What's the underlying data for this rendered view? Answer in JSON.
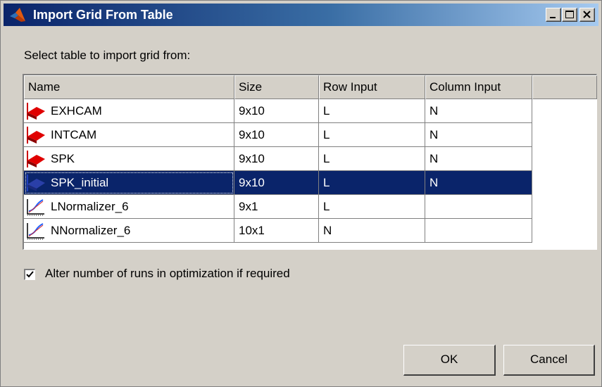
{
  "window": {
    "title": "Import Grid From Table",
    "controls": {
      "minimize": "_",
      "maximize": "□",
      "close": "X"
    }
  },
  "prompt": "Select table to import grid from:",
  "table": {
    "columns": [
      "Name",
      "Size",
      "Row Input",
      "Column Input"
    ],
    "rows": [
      {
        "name": "EXHCAM",
        "size": "9x10",
        "row_input": "L",
        "column_input": "N",
        "icon": "table-2d-icon",
        "selected": false
      },
      {
        "name": "INTCAM",
        "size": "9x10",
        "row_input": "L",
        "column_input": "N",
        "icon": "table-2d-icon",
        "selected": false
      },
      {
        "name": "SPK",
        "size": "9x10",
        "row_input": "L",
        "column_input": "N",
        "icon": "table-2d-icon",
        "selected": false
      },
      {
        "name": "SPK_initial",
        "size": "9x10",
        "row_input": "L",
        "column_input": "N",
        "icon": "table-2d-icon",
        "selected": true
      },
      {
        "name": "LNormalizer_6",
        "size": "9x1",
        "row_input": "L",
        "column_input": "",
        "icon": "normalizer-icon",
        "selected": false
      },
      {
        "name": "NNormalizer_6",
        "size": "10x1",
        "row_input": "N",
        "column_input": "",
        "icon": "normalizer-icon",
        "selected": false
      }
    ]
  },
  "option": {
    "label": "Alter number of runs in optimization if required",
    "checked": true
  },
  "buttons": {
    "ok": "OK",
    "cancel": "Cancel"
  },
  "colors": {
    "title_start": "#0a246a",
    "title_end": "#a6caf0",
    "selection": "#0a246a",
    "face": "#d4d0c8"
  }
}
